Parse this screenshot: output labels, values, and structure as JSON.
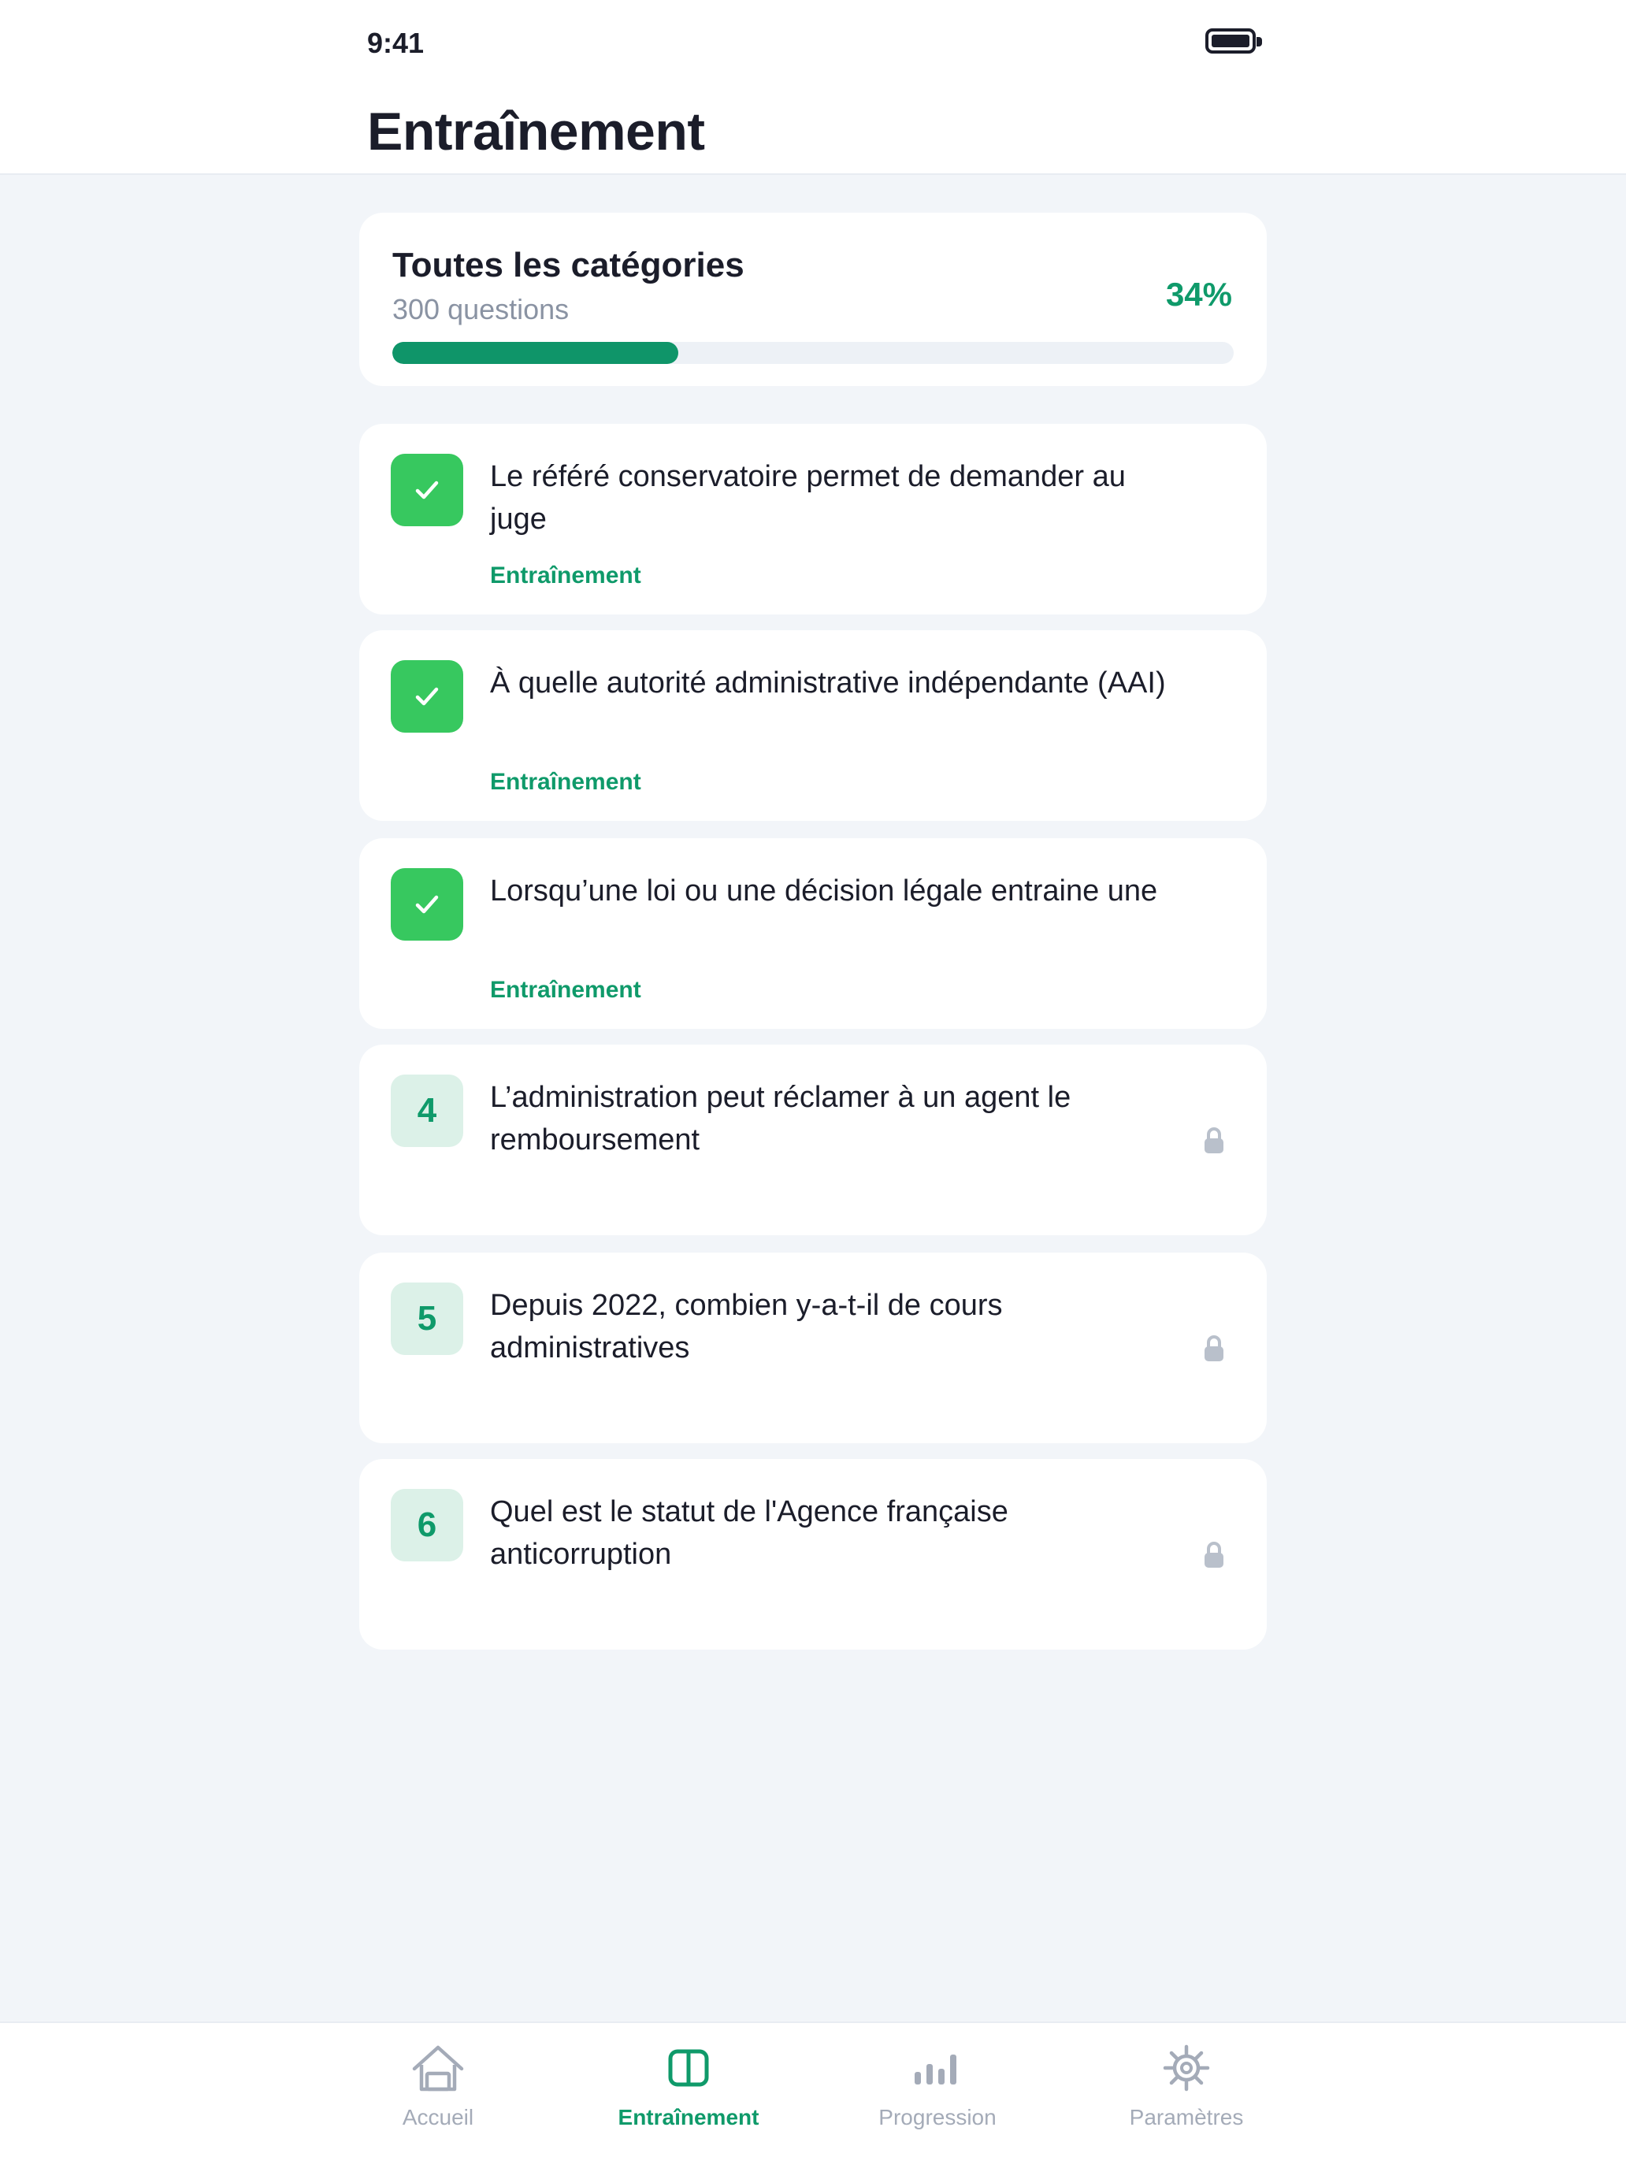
{
  "status_bar": {
    "time": "9:41"
  },
  "header": {
    "title": "Entraînement"
  },
  "summary": {
    "title": "Toutes les catégories",
    "subtitle": "300 questions",
    "percent_label": "34%",
    "progress": 0.34
  },
  "questions": [
    {
      "status": "done",
      "badge": "",
      "text": "Le référé conservatoire permet de demander au juge",
      "tag": "Entraînement"
    },
    {
      "status": "done",
      "badge": "",
      "text": "À quelle autorité administrative indépendante (AAI)",
      "tag": "Entraînement"
    },
    {
      "status": "done",
      "badge": "",
      "text": "Lorsqu’une loi ou une décision légale entraine une",
      "tag": "Entraînement"
    },
    {
      "status": "locked",
      "badge": "4",
      "text": "L’administration peut réclamer à un agent le remboursement",
      "tag": ""
    },
    {
      "status": "locked",
      "badge": "5",
      "text": "Depuis 2022, combien y-a-t-il de cours administratives",
      "tag": ""
    },
    {
      "status": "locked",
      "badge": "6",
      "text": "Quel est le statut de l'Agence française anticorruption",
      "tag": ""
    }
  ],
  "tabbar": {
    "tabs": [
      {
        "label": "Accueil",
        "icon": "home-icon",
        "active": false
      },
      {
        "label": "Entraînement",
        "icon": "book-icon",
        "active": true
      },
      {
        "label": "Progression",
        "icon": "bar-chart-icon",
        "active": false
      },
      {
        "label": "Paramètres",
        "icon": "gear-icon",
        "active": false
      }
    ]
  },
  "colors": {
    "accent": "#0f9a6a",
    "done_badge": "#37c85f",
    "number_badge_bg": "#dcf1e8",
    "background": "#f2f5f9",
    "inactive": "#a4abb8"
  }
}
